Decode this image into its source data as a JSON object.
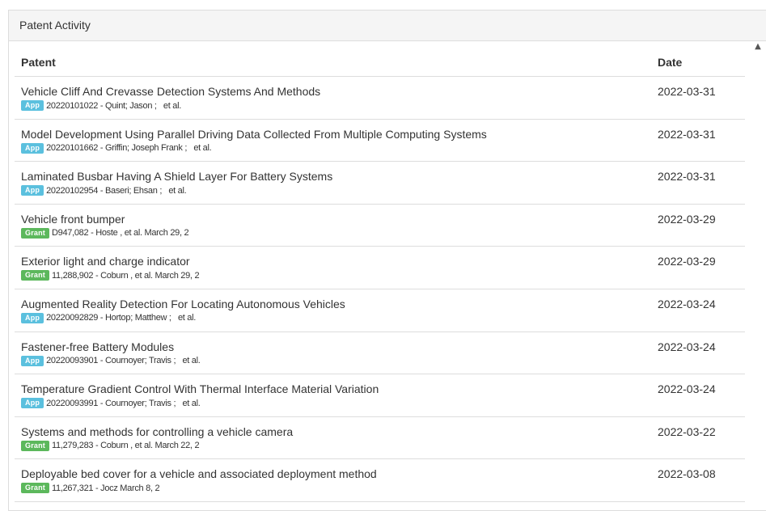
{
  "panel": {
    "title": "Patent Activity"
  },
  "table": {
    "headers": {
      "patent": "Patent",
      "date": "Date"
    },
    "rows": [
      {
        "title": "Vehicle Cliff And Crevasse Detection Systems And Methods",
        "badge": "App",
        "badge_type": "app",
        "meta": "20220101022 - Quint; Jason ;   et al.",
        "date": "2022-03-31"
      },
      {
        "title": "Model Development Using Parallel Driving Data Collected From Multiple Computing Systems",
        "badge": "App",
        "badge_type": "app",
        "meta": "20220101662 - Griffin; Joseph Frank ;   et al.",
        "date": "2022-03-31"
      },
      {
        "title": "Laminated Busbar Having A Shield Layer For Battery Systems",
        "badge": "App",
        "badge_type": "app",
        "meta": "20220102954 - Baseri; Ehsan ;   et al.",
        "date": "2022-03-31"
      },
      {
        "title": "Vehicle front bumper",
        "badge": "Grant",
        "badge_type": "grant",
        "meta": "D947,082 - Hoste , et al. March 29, 2",
        "date": "2022-03-29"
      },
      {
        "title": "Exterior light and charge indicator",
        "badge": "Grant",
        "badge_type": "grant",
        "meta": "11,288,902 - Coburn , et al. March 29, 2",
        "date": "2022-03-29"
      },
      {
        "title": "Augmented Reality Detection For Locating Autonomous Vehicles",
        "badge": "App",
        "badge_type": "app",
        "meta": "20220092829 - Hortop; Matthew ;   et al.",
        "date": "2022-03-24"
      },
      {
        "title": "Fastener-free Battery Modules",
        "badge": "App",
        "badge_type": "app",
        "meta": "20220093901 - Cournoyer; Travis ;   et al.",
        "date": "2022-03-24"
      },
      {
        "title": "Temperature Gradient Control With Thermal Interface Material Variation",
        "badge": "App",
        "badge_type": "app",
        "meta": "20220093991 - Cournoyer; Travis ;   et al.",
        "date": "2022-03-24"
      },
      {
        "title": "Systems and methods for controlling a vehicle camera",
        "badge": "Grant",
        "badge_type": "grant",
        "meta": "11,279,283 - Coburn , et al. March 22, 2",
        "date": "2022-03-22"
      },
      {
        "title": "Deployable bed cover for a vehicle and associated deployment method",
        "badge": "Grant",
        "badge_type": "grant",
        "meta": "11,267,321 - Jocz March 8, 2",
        "date": "2022-03-08"
      }
    ]
  },
  "scrollbar": {
    "up_arrow_icon": "triangle-up-icon",
    "glyph": "▲"
  },
  "colors": {
    "app_badge": "#5bc0de",
    "grant_badge": "#5cb85c",
    "border": "#dddddd",
    "heading_bg": "#f5f5f5"
  }
}
